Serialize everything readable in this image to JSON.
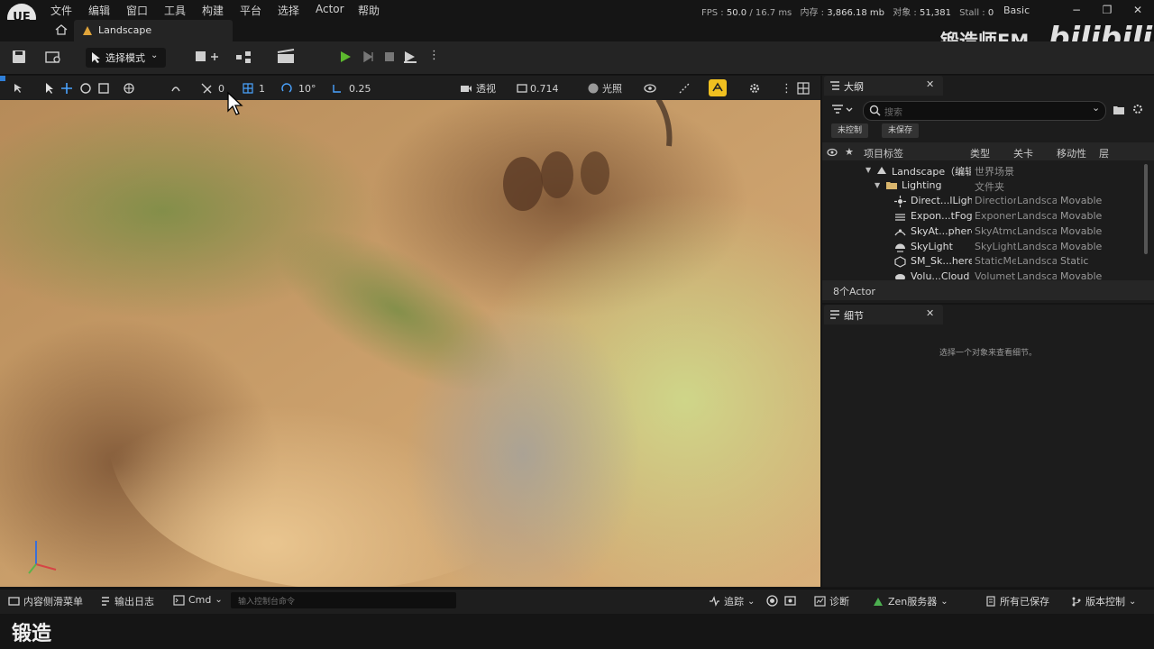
{
  "app": {
    "logo": "UE",
    "menu": [
      "文件",
      "编辑",
      "窗口",
      "工具",
      "构建",
      "平台",
      "选择",
      "Actor",
      "帮助"
    ],
    "stats": {
      "fps_label": "FPS :",
      "fps": "50.0",
      "ms": "/ 16.7 ms",
      "mem_label": "内存 :",
      "mem": "3,866.18 mb",
      "obj_label": "对象 :",
      "obj": "51,381",
      "stall_label": "Stall :",
      "stall": "0"
    },
    "profile": "Basic",
    "window_controls": [
      "−",
      "❐",
      "✕"
    ]
  },
  "tab": {
    "label": "Landscape"
  },
  "toolbar": {
    "mode_label": "选择模式"
  },
  "viewport_toolbar": {
    "snap_angle_value": "0",
    "grid_value": "1",
    "rotate_value": "10°",
    "scale_value": "0.25",
    "view_mode": "透视",
    "fov_value": "0.714",
    "lighting_label": "光照"
  },
  "outliner": {
    "title": "大纲",
    "search_placeholder": "搜索",
    "chips": [
      "未控制",
      "未保存"
    ],
    "columns": {
      "label": "项目标签",
      "type": "类型",
      "level": "关卡",
      "mobility": "移动性",
      "layer": "层"
    },
    "rows": [
      {
        "name": "Landscape（编辑",
        "type": "世界场景",
        "level": "",
        "mobility": ""
      },
      {
        "name": "Lighting",
        "type": "文件夹",
        "level": "",
        "mobility": ""
      },
      {
        "name": "Direct...lLight",
        "type": "Direction",
        "level": "Landsca",
        "mobility": "Movable"
      },
      {
        "name": "Expon...tFog",
        "type": "Exponen",
        "level": "Landsca",
        "mobility": "Movable"
      },
      {
        "name": "SkyAt...phere",
        "type": "SkyAtmo",
        "level": "Landsca",
        "mobility": "Movable"
      },
      {
        "name": "SkyLight",
        "type": "SkyLight",
        "level": "Landsca",
        "mobility": "Movable"
      },
      {
        "name": "SM_Sk...here",
        "type": "StaticMe",
        "level": "Landsca",
        "mobility": "Static"
      },
      {
        "name": "Volu...Cloud",
        "type": "Volumet",
        "level": "Landsca",
        "mobility": "Movable"
      }
    ],
    "actor_count": "8个Actor"
  },
  "details": {
    "title": "细节",
    "empty_text": "选择一个对象来查看细节。"
  },
  "bottombar": {
    "content_drawer": "内容侧滑菜单",
    "output_log": "输出日志",
    "cmd": "Cmd",
    "cmd_placeholder": "输入控制台命令",
    "trace": "追踪",
    "diagnostics": "诊断",
    "zen": "Zen服务器",
    "save_all": "所有已保存",
    "source_control": "版本控制"
  },
  "overlay": {
    "caption": "锻造",
    "watermark_text": "锻造师FM",
    "watermark_brand": "bilibili"
  }
}
